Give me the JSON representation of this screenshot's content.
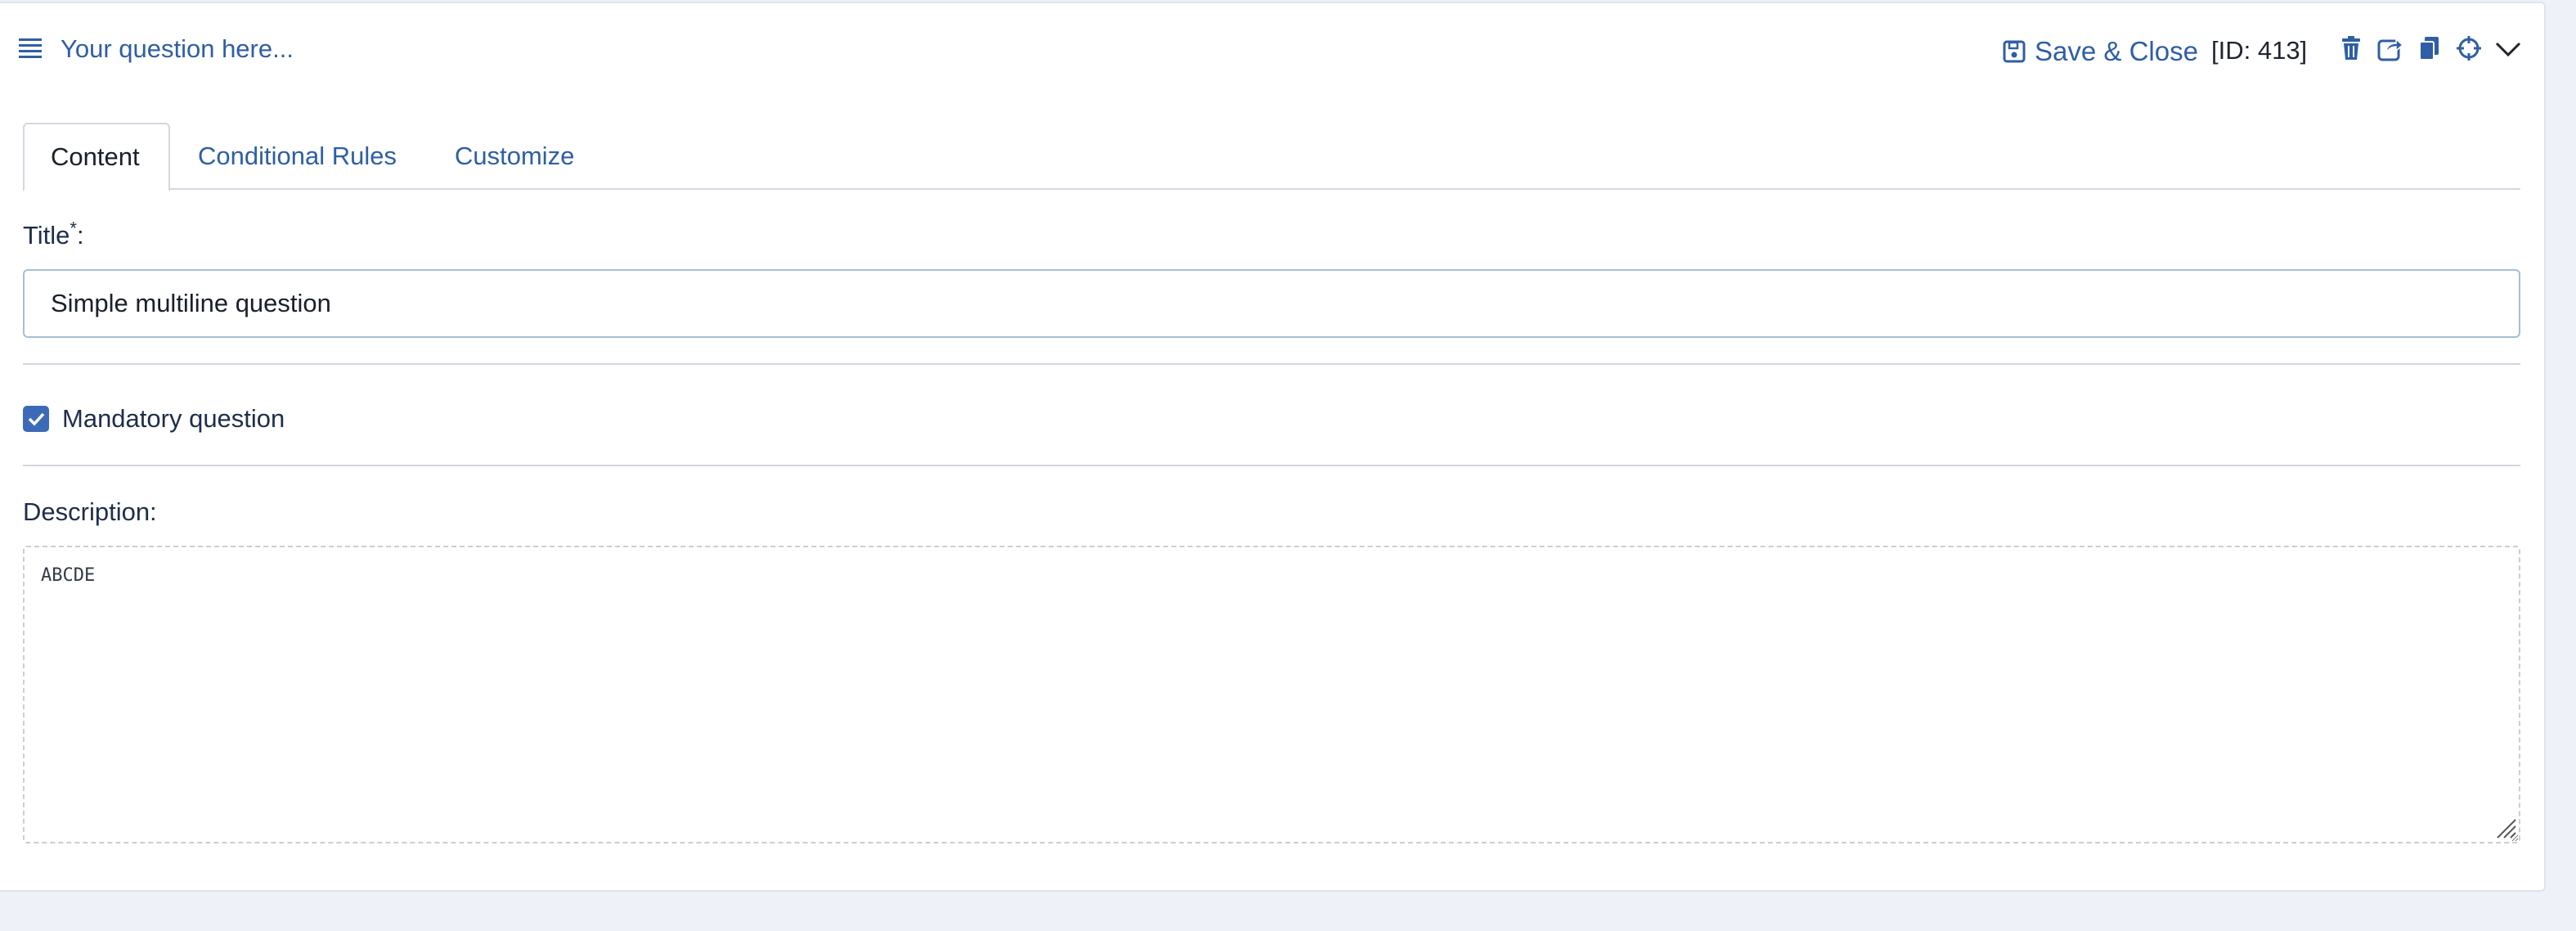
{
  "header": {
    "question_title": "Your question here...",
    "save_close_label": "Save & Close",
    "id_label": "[ID: 413]",
    "icons": [
      "drag-handle-icon",
      "save-icon",
      "trash-icon",
      "share-icon",
      "copy-icon",
      "crosshair-icon",
      "chevron-down-icon"
    ]
  },
  "tabs": [
    {
      "label": "Content",
      "active": true
    },
    {
      "label": "Conditional Rules",
      "active": false
    },
    {
      "label": "Customize",
      "active": false
    }
  ],
  "form": {
    "title_label": "Title",
    "required_marker": "*",
    "title_colon": ":",
    "title_value": "Simple multiline question",
    "mandatory_label": "Mandatory question",
    "mandatory_checked": true,
    "description_label": "Description:",
    "description_value": "ABCDE"
  },
  "colors": {
    "accent": "#2f5ea4",
    "checkbox": "#3b6bb8",
    "page_background": "#eef1f8"
  }
}
